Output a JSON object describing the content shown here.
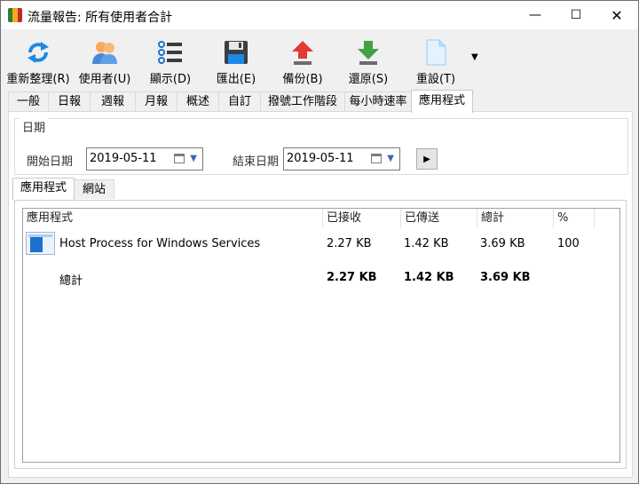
{
  "window": {
    "title": "流量報告: 所有使用者合計",
    "minimize_glyph": "—",
    "maximize_glyph": "☐",
    "close_glyph": "✕",
    "app_icon_colors": [
      "#2e7d32",
      "#f9a825",
      "#c62828"
    ]
  },
  "toolbar": {
    "items": [
      {
        "label": "重新整理(R)",
        "icon": "refresh-icon"
      },
      {
        "label": "使用者(U)",
        "icon": "users-icon"
      },
      {
        "label": "顯示(D)",
        "icon": "display-list-icon"
      },
      {
        "label": "匯出(E)",
        "icon": "save-disk-icon"
      },
      {
        "label": "備份(B)",
        "icon": "backup-upload-icon"
      },
      {
        "label": "還原(S)",
        "icon": "restore-download-icon"
      },
      {
        "label": "重設(T)",
        "icon": "document-reset-icon"
      }
    ],
    "more_glyph": "▼"
  },
  "tabs": [
    "一般",
    "日報",
    "週報",
    "月報",
    "概述",
    "自訂",
    "撥號工作階段",
    "每小時速率",
    "應用程式"
  ],
  "active_tab": "應用程式",
  "date_range": {
    "group_title": "日期",
    "start_label": "開始日期",
    "start_value": "2019-05-11",
    "end_label": "結束日期",
    "end_value": "2019-05-11",
    "dropdown_glyph": "▼",
    "go_glyph": "▶"
  },
  "subtabs": [
    "應用程式",
    "網站"
  ],
  "active_subtab": "應用程式",
  "table": {
    "columns": [
      "應用程式",
      "已接收",
      "已傳送",
      "總計",
      "%"
    ],
    "rows": [
      {
        "name": "Host Process for Windows Services",
        "received": "2.27 KB",
        "sent": "1.42 KB",
        "total": "3.69 KB",
        "percent": "100",
        "icon": "window-app-icon"
      }
    ],
    "total_row": {
      "label": "總計",
      "received": "2.27 KB",
      "sent": "1.42 KB",
      "total": "3.69 KB"
    }
  },
  "colors": {
    "accent_blue": "#1e88e5",
    "arrow_red": "#e53935",
    "arrow_green": "#43a047"
  }
}
